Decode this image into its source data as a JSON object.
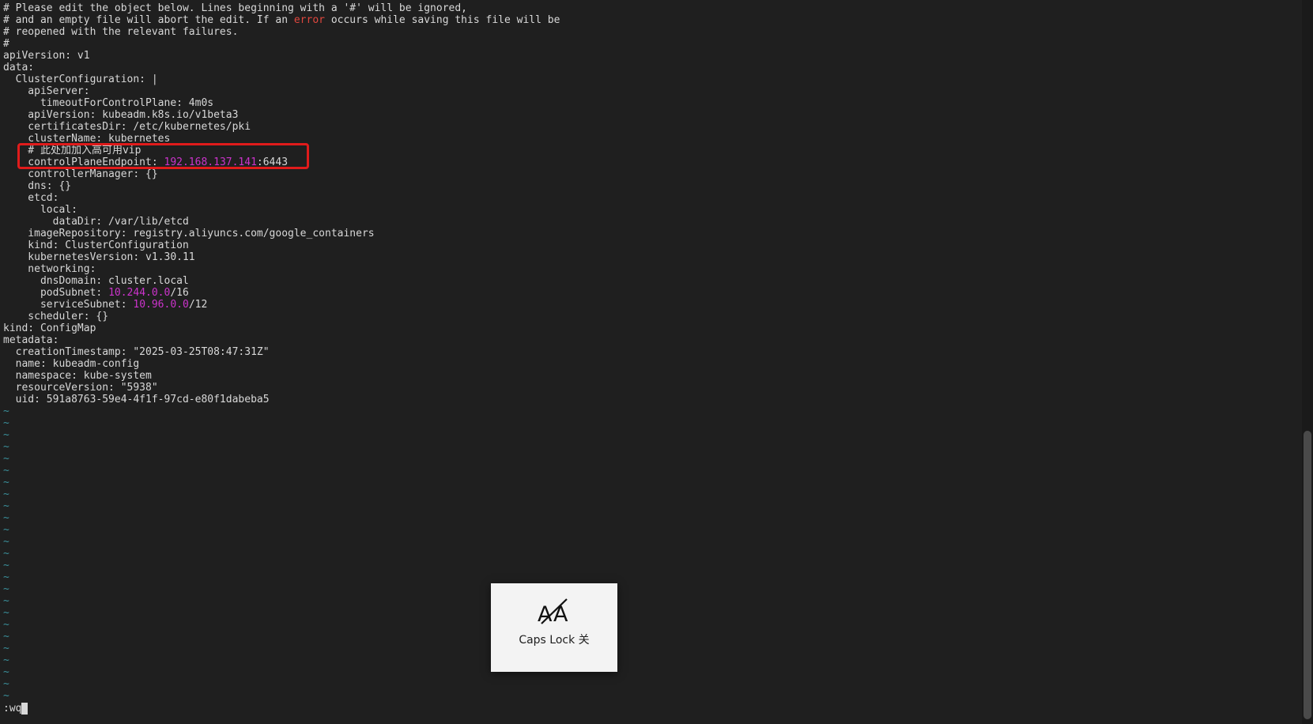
{
  "terminal": {
    "lines": [
      [
        {
          "t": "# Please edit the object below. Lines beginning with a '#' will be ignored,"
        }
      ],
      [
        {
          "t": "# and an empty file will abort the edit. If an "
        },
        {
          "t": "error",
          "c": "red"
        },
        {
          "t": " occurs while saving this file will be"
        }
      ],
      [
        {
          "t": "# reopened with the relevant failures."
        }
      ],
      [
        {
          "t": "#"
        }
      ],
      [
        {
          "t": "apiVersion: v1"
        }
      ],
      [
        {
          "t": "data:"
        }
      ],
      [
        {
          "t": "  ClusterConfiguration: |"
        }
      ],
      [
        {
          "t": "    apiServer:"
        }
      ],
      [
        {
          "t": "      timeoutForControlPlane: 4m0s"
        }
      ],
      [
        {
          "t": "    apiVersion: kubeadm.k8s.io/v1beta3"
        }
      ],
      [
        {
          "t": "    certificatesDir: /etc/kubernetes/pki"
        }
      ],
      [
        {
          "t": "    clusterName: kubernetes"
        }
      ],
      [
        {
          "t": "    # 此处加加入高可用vip"
        }
      ],
      [
        {
          "t": "    controlPlaneEndpoint: "
        },
        {
          "t": "192.168.137.141",
          "c": "magenta"
        },
        {
          "t": ":6443"
        }
      ],
      [
        {
          "t": "    controllerManager: {}"
        }
      ],
      [
        {
          "t": "    dns: {}"
        }
      ],
      [
        {
          "t": "    etcd:"
        }
      ],
      [
        {
          "t": "      local:"
        }
      ],
      [
        {
          "t": "        dataDir: /var/lib/etcd"
        }
      ],
      [
        {
          "t": "    imageRepository: registry.aliyuncs.com/google_containers"
        }
      ],
      [
        {
          "t": "    kind: ClusterConfiguration"
        }
      ],
      [
        {
          "t": "    kubernetesVersion: v1.30.11"
        }
      ],
      [
        {
          "t": "    networking:"
        }
      ],
      [
        {
          "t": "      dnsDomain: cluster.local"
        }
      ],
      [
        {
          "t": "      podSubnet: "
        },
        {
          "t": "10.244.0.0",
          "c": "magenta"
        },
        {
          "t": "/16"
        }
      ],
      [
        {
          "t": "      serviceSubnet: "
        },
        {
          "t": "10.96.0.0",
          "c": "magenta"
        },
        {
          "t": "/12"
        }
      ],
      [
        {
          "t": "    scheduler: {}"
        }
      ],
      [
        {
          "t": "kind: ConfigMap"
        }
      ],
      [
        {
          "t": "metadata:"
        }
      ],
      [
        {
          "t": "  creationTimestamp: \"2025-03-25T08:47:31Z\""
        }
      ],
      [
        {
          "t": "  name: kubeadm-config"
        }
      ],
      [
        {
          "t": "  namespace: kube-system"
        }
      ],
      [
        {
          "t": "  resourceVersion: \"5938\""
        }
      ],
      [
        {
          "t": "  uid: 591a8763-59e4-4f1f-97cd-e80f1dabeba5"
        }
      ]
    ],
    "empty_line_marker": "~",
    "empty_line_count": 25,
    "command_line": ":wq"
  },
  "caps_lock_osd": {
    "icon": "caps-lock-off-icon",
    "label": "Caps Lock 关"
  },
  "colors": {
    "background": "#1f1f1f",
    "text": "#d8d8d8",
    "error_red": "#e0473e",
    "number_magenta": "#cc33cc",
    "tilde": "#3a8f9a",
    "annotation_box": "#e01b1b"
  }
}
